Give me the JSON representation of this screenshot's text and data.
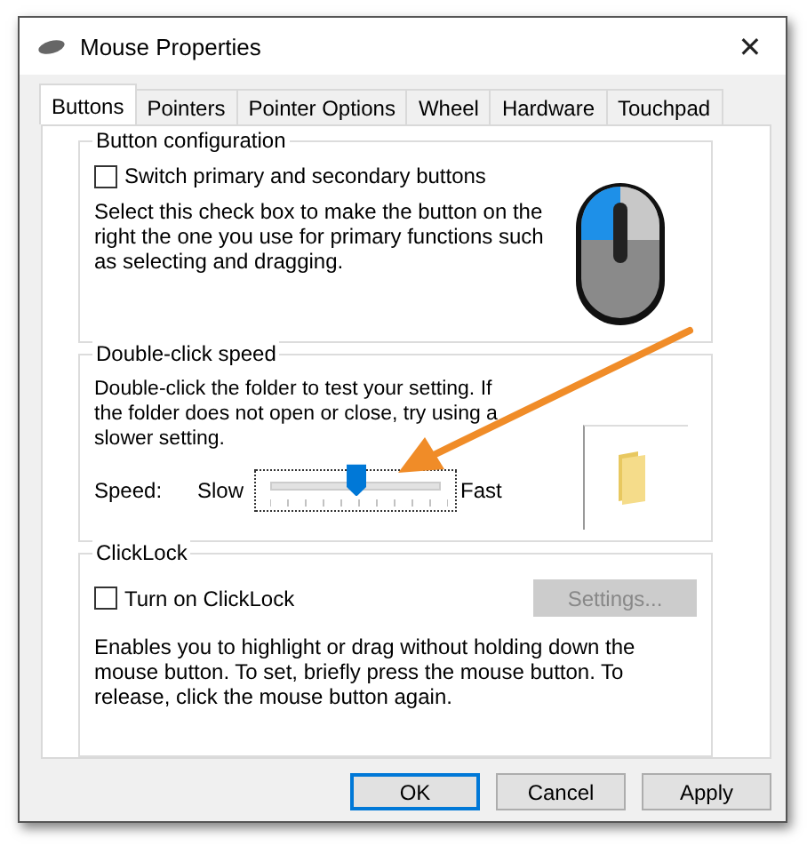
{
  "window": {
    "title": "Mouse Properties",
    "close": "✕"
  },
  "tabs": [
    {
      "label": "Buttons",
      "selected": true
    },
    {
      "label": "Pointers",
      "selected": false
    },
    {
      "label": "Pointer Options",
      "selected": false
    },
    {
      "label": "Wheel",
      "selected": false
    },
    {
      "label": "Hardware",
      "selected": false
    },
    {
      "label": "Touchpad",
      "selected": false
    }
  ],
  "button_configuration": {
    "title": "Button configuration",
    "checkbox": {
      "label": "Switch primary and secondary buttons",
      "checked": false
    },
    "description": "Select this check box to make the button on the right the one you use for primary functions such as selecting and dragging."
  },
  "double_click_speed": {
    "title": "Double-click speed",
    "description": "Double-click the folder to test your setting. If the folder does not open or close, try using a slower setting.",
    "speed_label": "Speed:",
    "slow": "Slow",
    "fast": "Fast",
    "level": 0.5
  },
  "click_lock": {
    "title": "ClickLock",
    "checkbox": {
      "label": "Turn on ClickLock",
      "checked": false
    },
    "settings_button": {
      "label": "Settings...",
      "disabled": true
    },
    "description": "Enables you to highlight or drag without holding down the mouse button. To set, briefly press the mouse button. To release, click the mouse button again."
  },
  "buttons": [
    {
      "label": "OK",
      "default": true
    },
    {
      "label": "Cancel",
      "default": false
    },
    {
      "label": "Apply",
      "default": false
    }
  ]
}
